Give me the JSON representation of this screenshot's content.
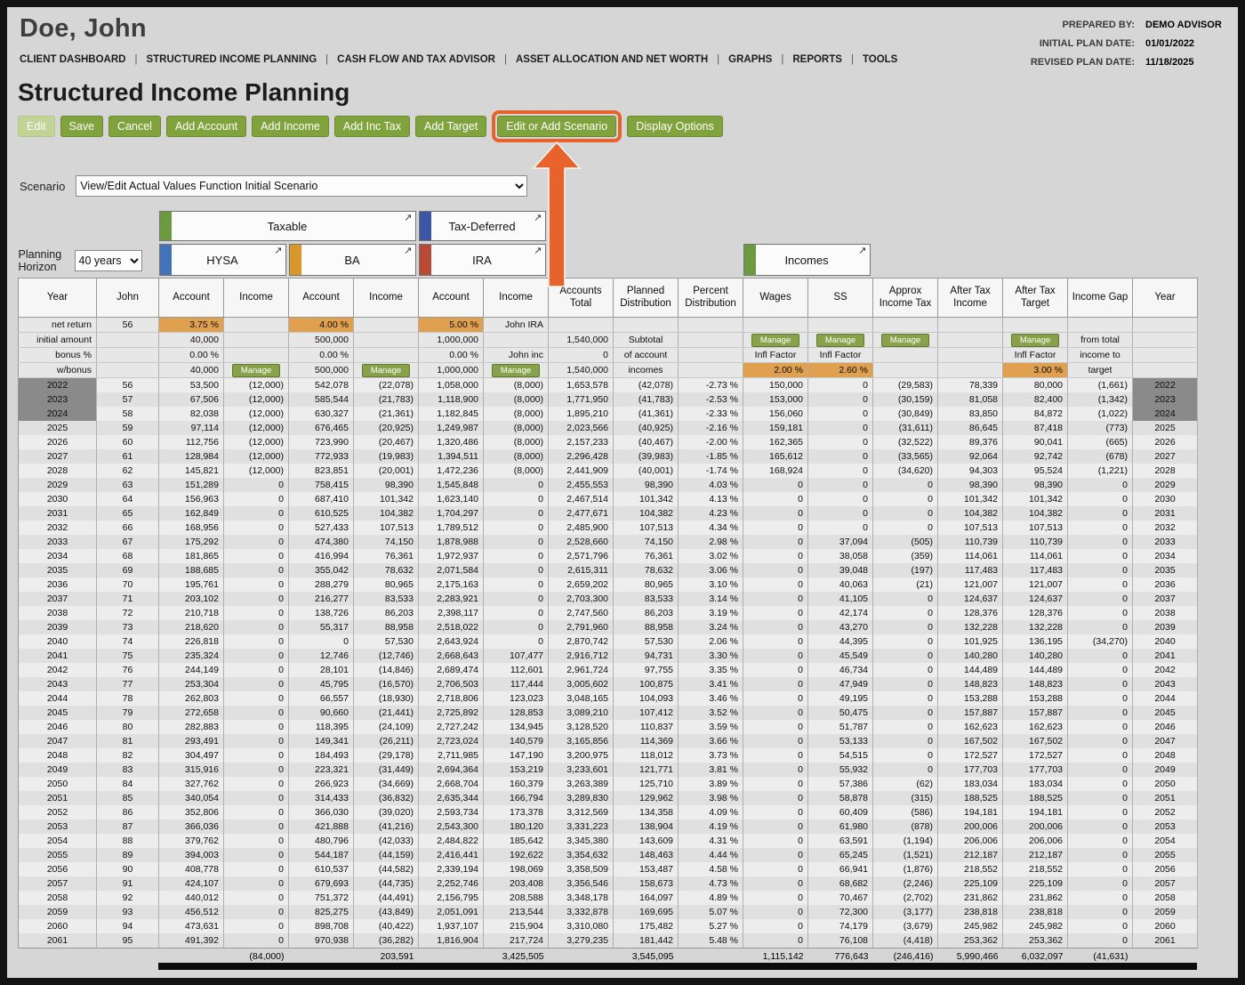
{
  "header": {
    "client_name": "Doe, John",
    "prepared_by_label": "PREPARED BY:",
    "prepared_by": "DEMO ADVISOR",
    "initial_plan_label": "INITIAL PLAN DATE:",
    "initial_plan_date": "01/01/2022",
    "revised_plan_label": "REVISED PLAN DATE:",
    "revised_plan_date": "11/18/2025",
    "nav": [
      "CLIENT DASHBOARD",
      "STRUCTURED INCOME PLANNING",
      "CASH FLOW AND TAX ADVISOR",
      "ASSET ALLOCATION AND NET WORTH",
      "GRAPHS",
      "REPORTS",
      "TOOLS"
    ]
  },
  "page": {
    "title": "Structured Income Planning",
    "toolbar": [
      "Edit",
      "Save",
      "Cancel",
      "Add Account",
      "Add Income",
      "Add Inc Tax",
      "Add Target",
      "Edit or Add Scenario",
      "Display Options"
    ],
    "scenario_label": "Scenario",
    "scenario_value": "View/Edit Actual Values Function Initial Scenario",
    "planning_horizon_label": "Planning Horizon",
    "planning_horizon_value": "40 years"
  },
  "groups": {
    "taxable": "Taxable",
    "tax_deferred": "Tax-Deferred",
    "hysa": "HYSA",
    "ba": "BA",
    "ira": "IRA",
    "incomes": "Incomes",
    "expand_icon": "↗"
  },
  "colors": {
    "button_green": "#81a33e",
    "manage_green": "#87a24b",
    "highlight_orange": "#e8622b",
    "rate_cell_orange": "#dfa050",
    "negative_pink": "#dcaab1",
    "selected_year_gray": "#8a8a8a"
  },
  "table": {
    "columns": [
      "Year",
      "John",
      "Account",
      "Income",
      "Account",
      "Income",
      "Account",
      "Income",
      "Accounts Total",
      "Planned Distribution",
      "Percent Distribution",
      "Wages",
      "SS",
      "Approx Income Tax",
      "After Tax Income",
      "After Tax Target",
      "Income Gap",
      "Year"
    ],
    "meta_rows": [
      {
        "cells": [
          "net return",
          "56",
          "3.75 %",
          "",
          "4.00 %",
          "",
          "5.00 %",
          "John IRA",
          "",
          "",
          "",
          "",
          "",
          "",
          "",
          "",
          "",
          ""
        ],
        "cls": [
          "label",
          "age",
          "rate",
          "empty",
          "rate",
          "empty",
          "rate",
          "name",
          "empty",
          "empty",
          "empty",
          "empty",
          "empty",
          "empty",
          "empty",
          "empty",
          "empty",
          "empty"
        ]
      },
      {
        "cells": [
          "initial amount",
          "",
          "40,000",
          "",
          "500,000",
          "",
          "1,000,000",
          "",
          "1,540,000",
          "Subtotal",
          "",
          "Manage",
          "Manage",
          "Manage",
          "",
          "Manage",
          "from total",
          ""
        ],
        "cls": [
          "label",
          "empty",
          "num",
          "empty",
          "num",
          "empty",
          "num",
          "empty",
          "num",
          "dist",
          "empty",
          "btn",
          "btn",
          "btn",
          "empty",
          "btn",
          "gap",
          "empty"
        ]
      },
      {
        "cells": [
          "bonus %",
          "",
          "0.00 %",
          "",
          "0.00 %",
          "",
          "0.00 %",
          "John inc",
          "0",
          "of account",
          "",
          "Infl Factor",
          "Infl Factor",
          "",
          "",
          "Infl Factor",
          "income to",
          ""
        ],
        "cls": [
          "label",
          "empty",
          "num",
          "empty",
          "num",
          "empty",
          "num",
          "name",
          "num",
          "dist",
          "empty",
          "infl",
          "infl",
          "empty",
          "empty",
          "infl",
          "gap",
          "empty"
        ]
      },
      {
        "cells": [
          "w/bonus",
          "",
          "40,000",
          "Manage",
          "500,000",
          "Manage",
          "1,000,000",
          "Manage",
          "1,540,000",
          "incomes",
          "",
          "2.00 %",
          "2.60 %",
          "",
          "",
          "3.00 %",
          "target",
          ""
        ],
        "cls": [
          "label",
          "empty",
          "num",
          "btn",
          "num",
          "btn",
          "num",
          "btn",
          "num",
          "dist",
          "empty",
          "rate",
          "rate",
          "empty",
          "empty",
          "rate",
          "gap",
          "empty"
        ]
      }
    ],
    "rows": [
      [
        "2022",
        "56",
        "53,500",
        "(12,000)",
        "542,078",
        "(22,078)",
        "1,058,000",
        "(8,000)",
        "1,653,578",
        "(42,078)",
        "-2.73 %",
        "150,000",
        "0",
        "(29,583)",
        "78,339",
        "80,000",
        "(1,661)",
        "2022"
      ],
      [
        "2023",
        "57",
        "67,506",
        "(12,000)",
        "585,544",
        "(21,783)",
        "1,118,900",
        "(8,000)",
        "1,771,950",
        "(41,783)",
        "-2.53 %",
        "153,000",
        "0",
        "(30,159)",
        "81,058",
        "82,400",
        "(1,342)",
        "2023"
      ],
      [
        "2024",
        "58",
        "82,038",
        "(12,000)",
        "630,327",
        "(21,361)",
        "1,182,845",
        "(8,000)",
        "1,895,210",
        "(41,361)",
        "-2.33 %",
        "156,060",
        "0",
        "(30,849)",
        "83,850",
        "84,872",
        "(1,022)",
        "2024"
      ],
      [
        "2025",
        "59",
        "97,114",
        "(12,000)",
        "676,465",
        "(20,925)",
        "1,249,987",
        "(8,000)",
        "2,023,566",
        "(40,925)",
        "-2.16 %",
        "159,181",
        "0",
        "(31,611)",
        "86,645",
        "87,418",
        "(773)",
        "2025"
      ],
      [
        "2026",
        "60",
        "112,756",
        "(12,000)",
        "723,990",
        "(20,467)",
        "1,320,486",
        "(8,000)",
        "2,157,233",
        "(40,467)",
        "-2.00 %",
        "162,365",
        "0",
        "(32,522)",
        "89,376",
        "90,041",
        "(665)",
        "2026"
      ],
      [
        "2027",
        "61",
        "128,984",
        "(12,000)",
        "772,933",
        "(19,983)",
        "1,394,511",
        "(8,000)",
        "2,296,428",
        "(39,983)",
        "-1.85 %",
        "165,612",
        "0",
        "(33,565)",
        "92,064",
        "92,742",
        "(678)",
        "2027"
      ],
      [
        "2028",
        "62",
        "145,821",
        "(12,000)",
        "823,851",
        "(20,001)",
        "1,472,236",
        "(8,000)",
        "2,441,909",
        "(40,001)",
        "-1.74 %",
        "168,924",
        "0",
        "(34,620)",
        "94,303",
        "95,524",
        "(1,221)",
        "2028"
      ],
      [
        "2029",
        "63",
        "151,289",
        "0",
        "758,415",
        "98,390",
        "1,545,848",
        "0",
        "2,455,553",
        "98,390",
        "4.03 %",
        "0",
        "0",
        "0",
        "98,390",
        "98,390",
        "0",
        "2029"
      ],
      [
        "2030",
        "64",
        "156,963",
        "0",
        "687,410",
        "101,342",
        "1,623,140",
        "0",
        "2,467,514",
        "101,342",
        "4.13 %",
        "0",
        "0",
        "0",
        "101,342",
        "101,342",
        "0",
        "2030"
      ],
      [
        "2031",
        "65",
        "162,849",
        "0",
        "610,525",
        "104,382",
        "1,704,297",
        "0",
        "2,477,671",
        "104,382",
        "4.23 %",
        "0",
        "0",
        "0",
        "104,382",
        "104,382",
        "0",
        "2031"
      ],
      [
        "2032",
        "66",
        "168,956",
        "0",
        "527,433",
        "107,513",
        "1,789,512",
        "0",
        "2,485,900",
        "107,513",
        "4.34 %",
        "0",
        "0",
        "0",
        "107,513",
        "107,513",
        "0",
        "2032"
      ],
      [
        "2033",
        "67",
        "175,292",
        "0",
        "474,380",
        "74,150",
        "1,878,988",
        "0",
        "2,528,660",
        "74,150",
        "2.98 %",
        "0",
        "37,094",
        "(505)",
        "110,739",
        "110,739",
        "0",
        "2033"
      ],
      [
        "2034",
        "68",
        "181,865",
        "0",
        "416,994",
        "76,361",
        "1,972,937",
        "0",
        "2,571,796",
        "76,361",
        "3.02 %",
        "0",
        "38,058",
        "(359)",
        "114,061",
        "114,061",
        "0",
        "2034"
      ],
      [
        "2035",
        "69",
        "188,685",
        "0",
        "355,042",
        "78,632",
        "2,071,584",
        "0",
        "2,615,311",
        "78,632",
        "3.06 %",
        "0",
        "39,048",
        "(197)",
        "117,483",
        "117,483",
        "0",
        "2035"
      ],
      [
        "2036",
        "70",
        "195,761",
        "0",
        "288,279",
        "80,965",
        "2,175,163",
        "0",
        "2,659,202",
        "80,965",
        "3.10 %",
        "0",
        "40,063",
        "(21)",
        "121,007",
        "121,007",
        "0",
        "2036"
      ],
      [
        "2037",
        "71",
        "203,102",
        "0",
        "216,277",
        "83,533",
        "2,283,921",
        "0",
        "2,703,300",
        "83,533",
        "3.14 %",
        "0",
        "41,105",
        "0",
        "124,637",
        "124,637",
        "0",
        "2037"
      ],
      [
        "2038",
        "72",
        "210,718",
        "0",
        "138,726",
        "86,203",
        "2,398,117",
        "0",
        "2,747,560",
        "86,203",
        "3.19 %",
        "0",
        "42,174",
        "0",
        "128,376",
        "128,376",
        "0",
        "2038"
      ],
      [
        "2039",
        "73",
        "218,620",
        "0",
        "55,317",
        "88,958",
        "2,518,022",
        "0",
        "2,791,960",
        "88,958",
        "3.24 %",
        "0",
        "43,270",
        "0",
        "132,228",
        "132,228",
        "0",
        "2039"
      ],
      [
        "2040",
        "74",
        "226,818",
        "0",
        "0",
        "57,530",
        "2,643,924",
        "0",
        "2,870,742",
        "57,530",
        "2.06 %",
        "0",
        "44,395",
        "0",
        "101,925",
        "136,195",
        "(34,270)",
        "2040"
      ],
      [
        "2041",
        "75",
        "235,324",
        "0",
        "12,746",
        "(12,746)",
        "2,668,643",
        "107,477",
        "2,916,712",
        "94,731",
        "3.30 %",
        "0",
        "45,549",
        "0",
        "140,280",
        "140,280",
        "0",
        "2041"
      ],
      [
        "2042",
        "76",
        "244,149",
        "0",
        "28,101",
        "(14,846)",
        "2,689,474",
        "112,601",
        "2,961,724",
        "97,755",
        "3.35 %",
        "0",
        "46,734",
        "0",
        "144,489",
        "144,489",
        "0",
        "2042"
      ],
      [
        "2043",
        "77",
        "253,304",
        "0",
        "45,795",
        "(16,570)",
        "2,706,503",
        "117,444",
        "3,005,602",
        "100,875",
        "3.41 %",
        "0",
        "47,949",
        "0",
        "148,823",
        "148,823",
        "0",
        "2043"
      ],
      [
        "2044",
        "78",
        "262,803",
        "0",
        "66,557",
        "(18,930)",
        "2,718,806",
        "123,023",
        "3,048,165",
        "104,093",
        "3.46 %",
        "0",
        "49,195",
        "0",
        "153,288",
        "153,288",
        "0",
        "2044"
      ],
      [
        "2045",
        "79",
        "272,658",
        "0",
        "90,660",
        "(21,441)",
        "2,725,892",
        "128,853",
        "3,089,210",
        "107,412",
        "3.52 %",
        "0",
        "50,475",
        "0",
        "157,887",
        "157,887",
        "0",
        "2045"
      ],
      [
        "2046",
        "80",
        "282,883",
        "0",
        "118,395",
        "(24,109)",
        "2,727,242",
        "134,945",
        "3,128,520",
        "110,837",
        "3.59 %",
        "0",
        "51,787",
        "0",
        "162,623",
        "162,623",
        "0",
        "2046"
      ],
      [
        "2047",
        "81",
        "293,491",
        "0",
        "149,341",
        "(26,211)",
        "2,723,024",
        "140,579",
        "3,165,856",
        "114,369",
        "3.66 %",
        "0",
        "53,133",
        "0",
        "167,502",
        "167,502",
        "0",
        "2047"
      ],
      [
        "2048",
        "82",
        "304,497",
        "0",
        "184,493",
        "(29,178)",
        "2,711,985",
        "147,190",
        "3,200,975",
        "118,012",
        "3.73 %",
        "0",
        "54,515",
        "0",
        "172,527",
        "172,527",
        "0",
        "2048"
      ],
      [
        "2049",
        "83",
        "315,916",
        "0",
        "223,321",
        "(31,449)",
        "2,694,364",
        "153,219",
        "3,233,601",
        "121,771",
        "3.81 %",
        "0",
        "55,932",
        "0",
        "177,703",
        "177,703",
        "0",
        "2049"
      ],
      [
        "2050",
        "84",
        "327,762",
        "0",
        "266,923",
        "(34,669)",
        "2,668,704",
        "160,379",
        "3,263,389",
        "125,710",
        "3.89 %",
        "0",
        "57,386",
        "(62)",
        "183,034",
        "183,034",
        "0",
        "2050"
      ],
      [
        "2051",
        "85",
        "340,054",
        "0",
        "314,433",
        "(36,832)",
        "2,635,344",
        "166,794",
        "3,289,830",
        "129,962",
        "3.98 %",
        "0",
        "58,878",
        "(315)",
        "188,525",
        "188,525",
        "0",
        "2051"
      ],
      [
        "2052",
        "86",
        "352,806",
        "0",
        "366,030",
        "(39,020)",
        "2,593,734",
        "173,378",
        "3,312,569",
        "134,358",
        "4.09 %",
        "0",
        "60,409",
        "(586)",
        "194,181",
        "194,181",
        "0",
        "2052"
      ],
      [
        "2053",
        "87",
        "366,036",
        "0",
        "421,888",
        "(41,216)",
        "2,543,300",
        "180,120",
        "3,331,223",
        "138,904",
        "4.19 %",
        "0",
        "61,980",
        "(878)",
        "200,006",
        "200,006",
        "0",
        "2053"
      ],
      [
        "2054",
        "88",
        "379,762",
        "0",
        "480,796",
        "(42,033)",
        "2,484,822",
        "185,642",
        "3,345,380",
        "143,609",
        "4.31 %",
        "0",
        "63,591",
        "(1,194)",
        "206,006",
        "206,006",
        "0",
        "2054"
      ],
      [
        "2055",
        "89",
        "394,003",
        "0",
        "544,187",
        "(44,159)",
        "2,416,441",
        "192,622",
        "3,354,632",
        "148,463",
        "4.44 %",
        "0",
        "65,245",
        "(1,521)",
        "212,187",
        "212,187",
        "0",
        "2055"
      ],
      [
        "2056",
        "90",
        "408,778",
        "0",
        "610,537",
        "(44,582)",
        "2,339,194",
        "198,069",
        "3,358,509",
        "153,487",
        "4.58 %",
        "0",
        "66,941",
        "(1,876)",
        "218,552",
        "218,552",
        "0",
        "2056"
      ],
      [
        "2057",
        "91",
        "424,107",
        "0",
        "679,693",
        "(44,735)",
        "2,252,746",
        "203,408",
        "3,356,546",
        "158,673",
        "4.73 %",
        "0",
        "68,682",
        "(2,246)",
        "225,109",
        "225,109",
        "0",
        "2057"
      ],
      [
        "2058",
        "92",
        "440,012",
        "0",
        "751,372",
        "(44,491)",
        "2,156,795",
        "208,588",
        "3,348,178",
        "164,097",
        "4.89 %",
        "0",
        "70,467",
        "(2,702)",
        "231,862",
        "231,862",
        "0",
        "2058"
      ],
      [
        "2059",
        "93",
        "456,512",
        "0",
        "825,275",
        "(43,849)",
        "2,051,091",
        "213,544",
        "3,332,878",
        "169,695",
        "5.07 %",
        "0",
        "72,300",
        "(3,177)",
        "238,818",
        "238,818",
        "0",
        "2059"
      ],
      [
        "2060",
        "94",
        "473,631",
        "0",
        "898,708",
        "(40,422)",
        "1,937,107",
        "215,904",
        "3,310,080",
        "175,482",
        "5.27 %",
        "0",
        "74,179",
        "(3,679)",
        "245,982",
        "245,982",
        "0",
        "2060"
      ],
      [
        "2061",
        "95",
        "491,392",
        "0",
        "970,938",
        "(36,282)",
        "1,816,904",
        "217,724",
        "3,279,235",
        "181,442",
        "5.48 %",
        "0",
        "76,108",
        "(4,418)",
        "253,362",
        "253,362",
        "0",
        "2061"
      ]
    ],
    "totals": [
      "",
      "",
      "",
      "(84,000)",
      "",
      "203,591",
      "",
      "3,425,505",
      "",
      "3,545,095",
      "",
      "1,115,142",
      "776,643",
      "(246,416)",
      "5,990,466",
      "6,032,097",
      "(41,631)",
      ""
    ]
  }
}
